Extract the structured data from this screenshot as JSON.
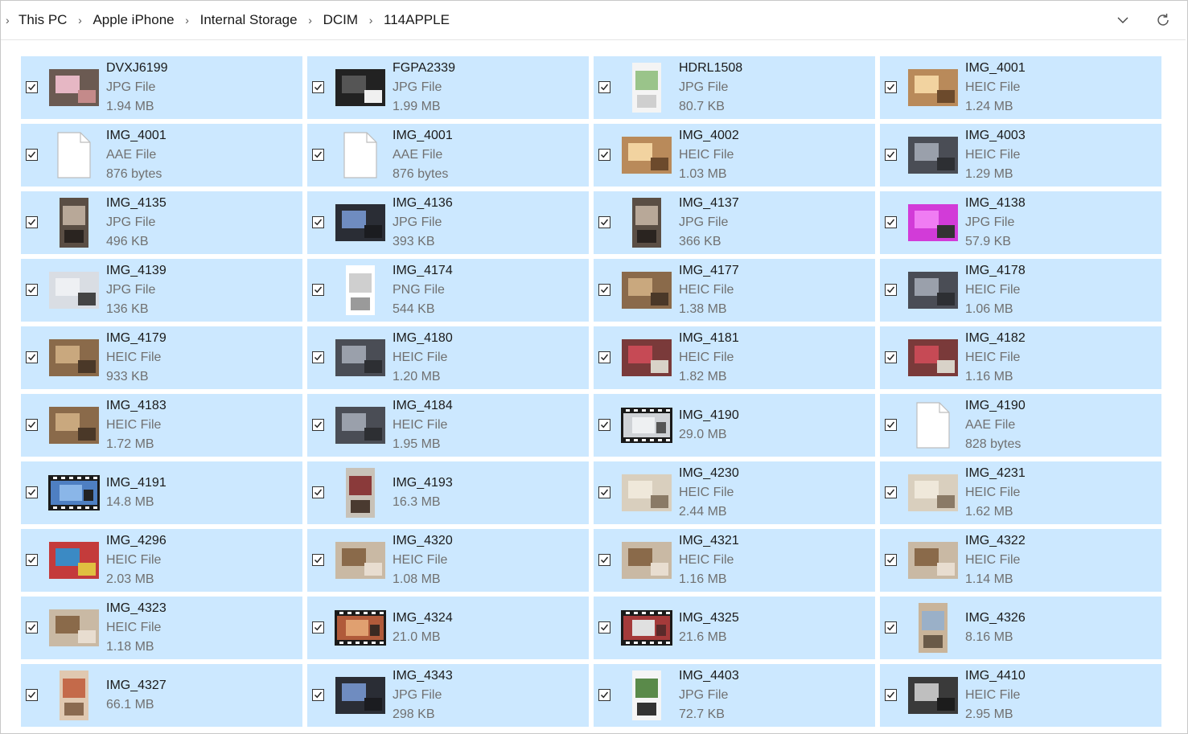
{
  "breadcrumb": [
    "This PC",
    "Apple iPhone",
    "Internal Storage",
    "DCIM",
    "114APPLE"
  ],
  "icons": {
    "dropdown": "chevron-down-icon",
    "refresh": "refresh-icon"
  },
  "colors": {
    "tile_selected": "#cce8ff",
    "meta_text": "#707070"
  },
  "files": [
    {
      "name": "DVXJ6199",
      "type": "JPG File",
      "size": "1.94 MB",
      "thumb": "photo-pink"
    },
    {
      "name": "FGPA2339",
      "type": "JPG File",
      "size": "1.99 MB",
      "thumb": "photo-dark"
    },
    {
      "name": "HDRL1508",
      "type": "JPG File",
      "size": "80.7 KB",
      "thumb": "portrait-screenshot"
    },
    {
      "name": "IMG_4001",
      "type": "HEIC File",
      "size": "1.24 MB",
      "thumb": "photo-food"
    },
    {
      "name": "IMG_4001",
      "type": "AAE File",
      "size": "876 bytes",
      "thumb": "file"
    },
    {
      "name": "IMG_4001",
      "type": "AAE File",
      "size": "876 bytes",
      "thumb": "file"
    },
    {
      "name": "IMG_4002",
      "type": "HEIC File",
      "size": "1.03 MB",
      "thumb": "photo-food"
    },
    {
      "name": "IMG_4003",
      "type": "HEIC File",
      "size": "1.29 MB",
      "thumb": "photo-room"
    },
    {
      "name": "IMG_4135",
      "type": "JPG File",
      "size": "496 KB",
      "thumb": "portrait-room"
    },
    {
      "name": "IMG_4136",
      "type": "JPG File",
      "size": "393 KB",
      "thumb": "photo-desk"
    },
    {
      "name": "IMG_4137",
      "type": "JPG File",
      "size": "366 KB",
      "thumb": "portrait-room"
    },
    {
      "name": "IMG_4138",
      "type": "JPG File",
      "size": "57.9 KB",
      "thumb": "photo-magenta"
    },
    {
      "name": "IMG_4139",
      "type": "JPG File",
      "size": "136 KB",
      "thumb": "photo-light"
    },
    {
      "name": "IMG_4174",
      "type": "PNG File",
      "size": "544 KB",
      "thumb": "portrait-doc"
    },
    {
      "name": "IMG_4177",
      "type": "HEIC File",
      "size": "1.38 MB",
      "thumb": "photo-wood"
    },
    {
      "name": "IMG_4178",
      "type": "HEIC File",
      "size": "1.06 MB",
      "thumb": "photo-room"
    },
    {
      "name": "IMG_4179",
      "type": "HEIC File",
      "size": "933 KB",
      "thumb": "photo-wood"
    },
    {
      "name": "IMG_4180",
      "type": "HEIC File",
      "size": "1.20 MB",
      "thumb": "photo-room"
    },
    {
      "name": "IMG_4181",
      "type": "HEIC File",
      "size": "1.82 MB",
      "thumb": "photo-red"
    },
    {
      "name": "IMG_4182",
      "type": "HEIC File",
      "size": "1.16 MB",
      "thumb": "photo-red"
    },
    {
      "name": "IMG_4183",
      "type": "HEIC File",
      "size": "1.72 MB",
      "thumb": "photo-wood"
    },
    {
      "name": "IMG_4184",
      "type": "HEIC File",
      "size": "1.95 MB",
      "thumb": "photo-room"
    },
    {
      "name": "IMG_4190",
      "type": "",
      "size": "29.0 MB",
      "thumb": "video-light"
    },
    {
      "name": "IMG_4190",
      "type": "AAE File",
      "size": "828 bytes",
      "thumb": "file"
    },
    {
      "name": "IMG_4191",
      "type": "",
      "size": "14.8 MB",
      "thumb": "video-sky"
    },
    {
      "name": "IMG_4193",
      "type": "",
      "size": "16.3 MB",
      "thumb": "portrait-person"
    },
    {
      "name": "IMG_4230",
      "type": "HEIC File",
      "size": "2.44 MB",
      "thumb": "photo-ceiling"
    },
    {
      "name": "IMG_4231",
      "type": "HEIC File",
      "size": "1.62 MB",
      "thumb": "photo-ceiling"
    },
    {
      "name": "IMG_4296",
      "type": "HEIC File",
      "size": "2.03 MB",
      "thumb": "photo-colorful"
    },
    {
      "name": "IMG_4320",
      "type": "HEIC File",
      "size": "1.08 MB",
      "thumb": "photo-kids"
    },
    {
      "name": "IMG_4321",
      "type": "HEIC File",
      "size": "1.16 MB",
      "thumb": "photo-kids"
    },
    {
      "name": "IMG_4322",
      "type": "HEIC File",
      "size": "1.14 MB",
      "thumb": "photo-kids"
    },
    {
      "name": "IMG_4323",
      "type": "HEIC File",
      "size": "1.18 MB",
      "thumb": "photo-kids"
    },
    {
      "name": "IMG_4324",
      "type": "",
      "size": "21.0 MB",
      "thumb": "video-warm"
    },
    {
      "name": "IMG_4325",
      "type": "",
      "size": "21.6 MB",
      "thumb": "video-red"
    },
    {
      "name": "IMG_4326",
      "type": "",
      "size": "8.16 MB",
      "thumb": "portrait-keyboard"
    },
    {
      "name": "IMG_4327",
      "type": "",
      "size": "66.1 MB",
      "thumb": "portrait-kid"
    },
    {
      "name": "IMG_4343",
      "type": "JPG File",
      "size": "298 KB",
      "thumb": "photo-desk"
    },
    {
      "name": "IMG_4403",
      "type": "JPG File",
      "size": "72.7 KB",
      "thumb": "portrait-meme"
    },
    {
      "name": "IMG_4410",
      "type": "HEIC File",
      "size": "2.95 MB",
      "thumb": "photo-laptop"
    }
  ]
}
